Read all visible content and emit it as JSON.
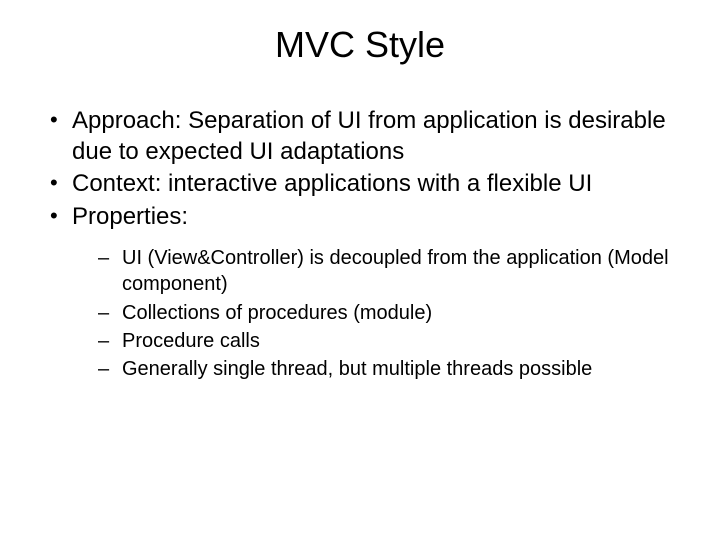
{
  "title": "MVC Style",
  "bullets": [
    "Approach: Separation of UI from application is desirable due to expected UI adaptations",
    "Context: interactive applications with a flexible UI",
    "Properties:"
  ],
  "sub_bullets": [
    " UI (View&Controller) is decoupled from the application (Model component)",
    "Collections of procedures (module)",
    "Procedure calls",
    "Generally single thread, but multiple threads possible"
  ]
}
